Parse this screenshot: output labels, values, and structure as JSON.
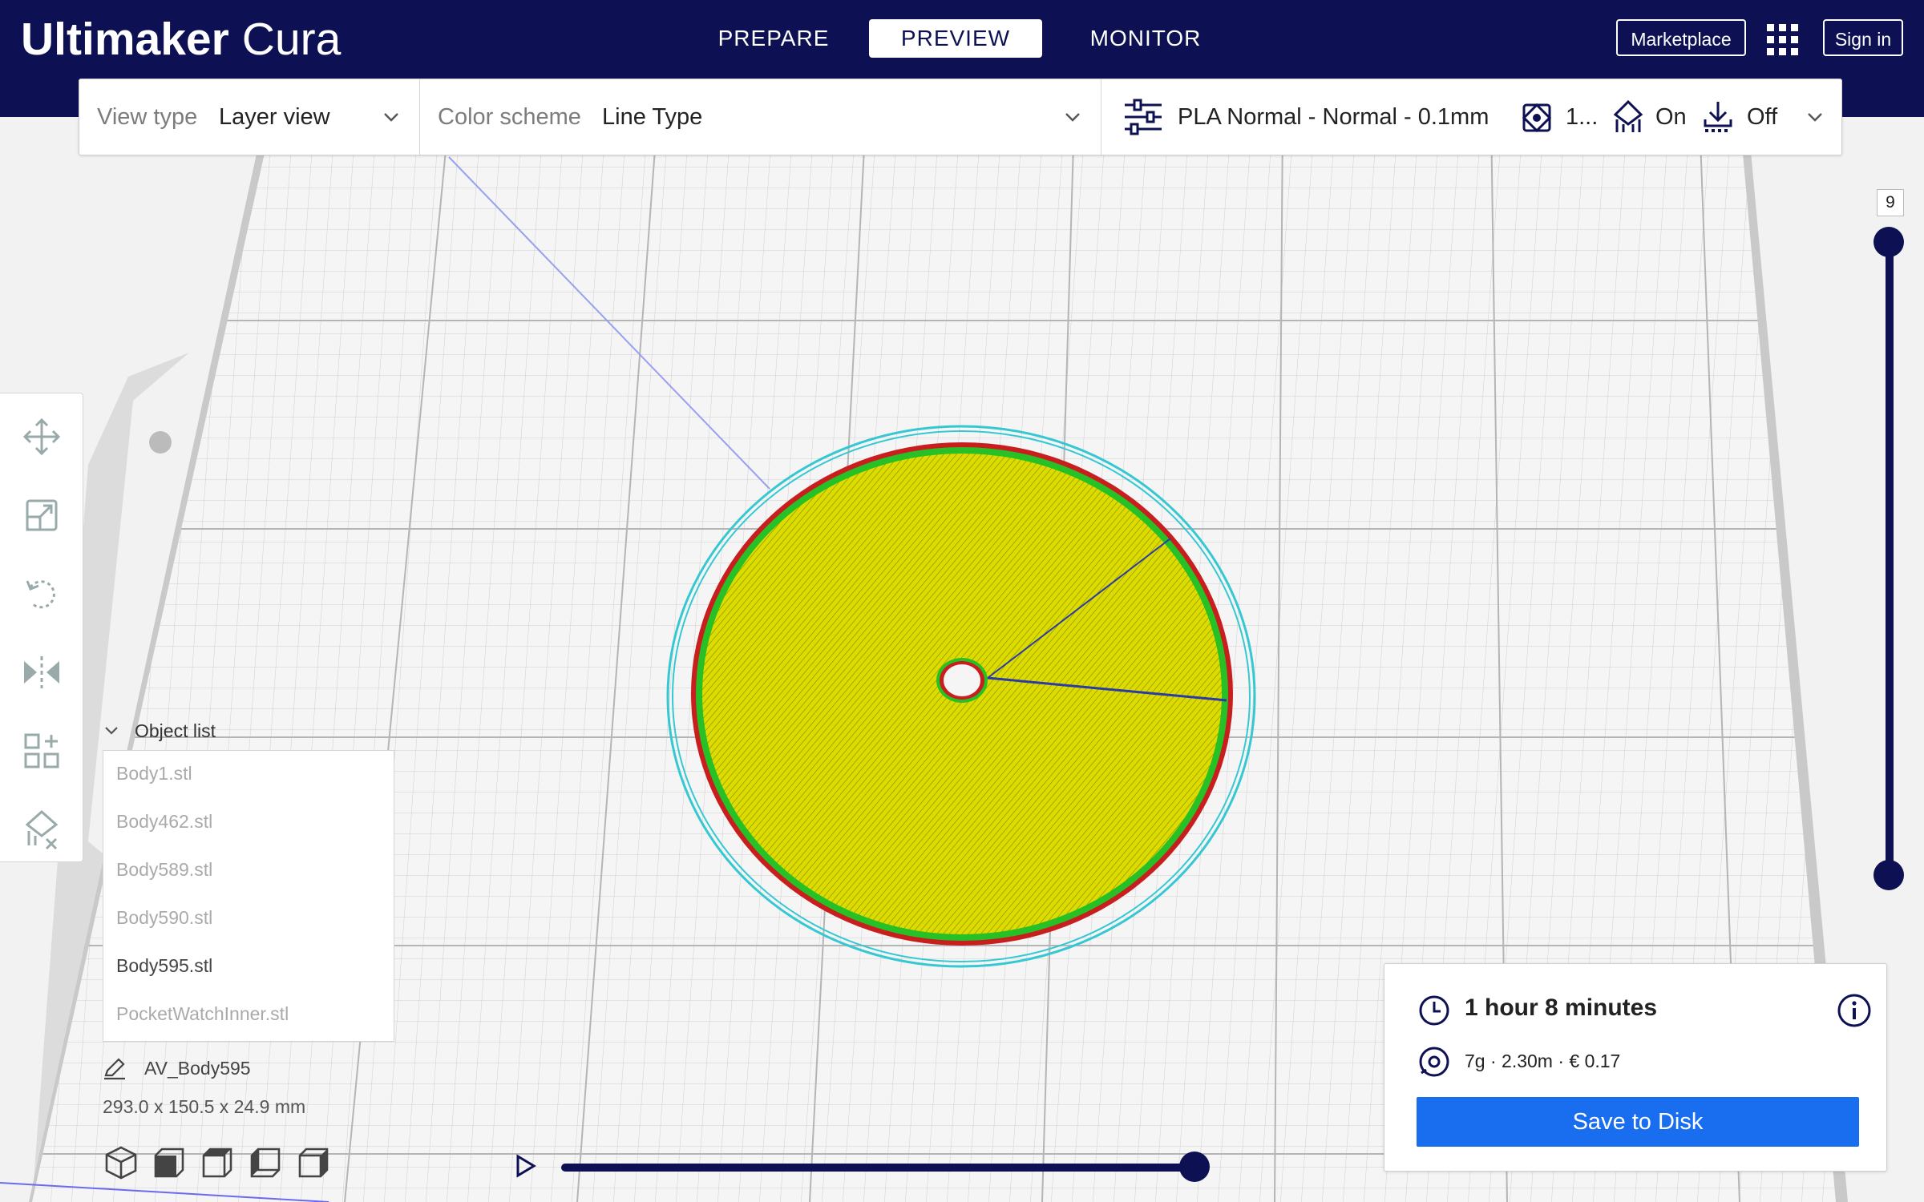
{
  "app": {
    "logo_bold": "Ultimaker",
    "logo_light": "Cura",
    "brand_color": "#0d1153",
    "accent_color": "#196ef0"
  },
  "stages": [
    {
      "label": "PREPARE",
      "active": false
    },
    {
      "label": "PREVIEW",
      "active": true
    },
    {
      "label": "MONITOR",
      "active": false
    }
  ],
  "header": {
    "marketplace_label": "Marketplace",
    "signin_label": "Sign in",
    "apps_icon": "grid-apps-icon"
  },
  "toolbar": {
    "view_type_label": "View type",
    "view_type_value": "Layer view",
    "color_scheme_label": "Color scheme",
    "color_scheme_value": "Line Type",
    "profile": "PLA Normal - Normal - 0.1mm",
    "infill": "1...",
    "support": "On",
    "adhesion": "Off"
  },
  "tools": [
    "move-icon",
    "scale-icon",
    "rotate-icon",
    "mirror-icon",
    "per-model-settings-icon",
    "support-blocker-icon"
  ],
  "object_list": {
    "header": "Object list",
    "items": [
      {
        "name": "Body1.stl",
        "selected": false
      },
      {
        "name": "Body462.stl",
        "selected": false
      },
      {
        "name": "Body589.stl",
        "selected": false
      },
      {
        "name": "Body590.stl",
        "selected": false
      },
      {
        "name": "Body595.stl",
        "selected": true
      },
      {
        "name": "PocketWatchInner.stl",
        "selected": false
      }
    ],
    "job_name": "AV_Body595",
    "dimensions": "293.0 x 150.5 x 24.9 mm"
  },
  "view_buttons": [
    "3d-view-icon",
    "front-view-icon",
    "top-view-icon",
    "left-view-icon",
    "right-view-icon"
  ],
  "layer_slider": {
    "current_layer": "9",
    "upper_fraction": 1.0,
    "lower_fraction": 0.0
  },
  "path_slider": {
    "position_fraction": 1.0
  },
  "print_info": {
    "time": "1 hour 8 minutes",
    "material": "7g · 2.30m · € 0.17",
    "save_label": "Save to Disk"
  },
  "model_colors": {
    "infill": "#d8d800",
    "wall_outer": "#c81e1e",
    "wall_inner": "#27c127",
    "skirt": "#35c8d2"
  }
}
